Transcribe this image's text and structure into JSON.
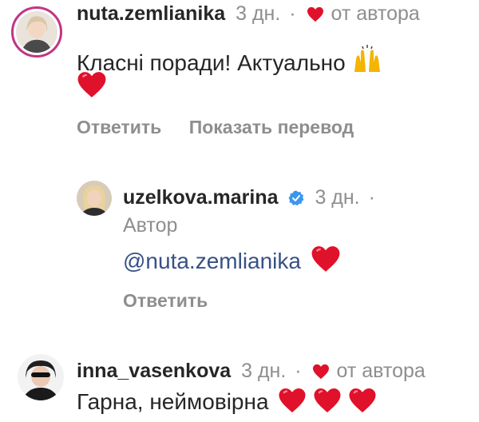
{
  "comments": [
    {
      "username": "nuta.zemlianika",
      "time": "3 дн.",
      "dot": "·",
      "liked_by_author": "от автора",
      "text": "Класні поради! Актуально",
      "actions": [
        "Ответить",
        "Показать перевод"
      ]
    },
    {
      "username": "uzelkova.marina",
      "time": "3 дн.",
      "dot": "·",
      "author_label": "Автор",
      "mention": "@nuta.zemlianika",
      "actions": [
        "Ответить"
      ]
    },
    {
      "username": "inna_vasenkova",
      "time": "3 дн.",
      "dot": "·",
      "liked_by_author": "от автора",
      "text": "Гарна, неймовірна"
    }
  ],
  "colors": {
    "heart": "#e0112b",
    "mention": "#385185",
    "muted": "#8e8e8e",
    "verified": "#3897f0",
    "avatar_ring": "#c13584"
  },
  "icons": {
    "heart": "heart-icon",
    "verified": "verified-badge-icon",
    "raised_hands": "raised-hands-emoji"
  }
}
